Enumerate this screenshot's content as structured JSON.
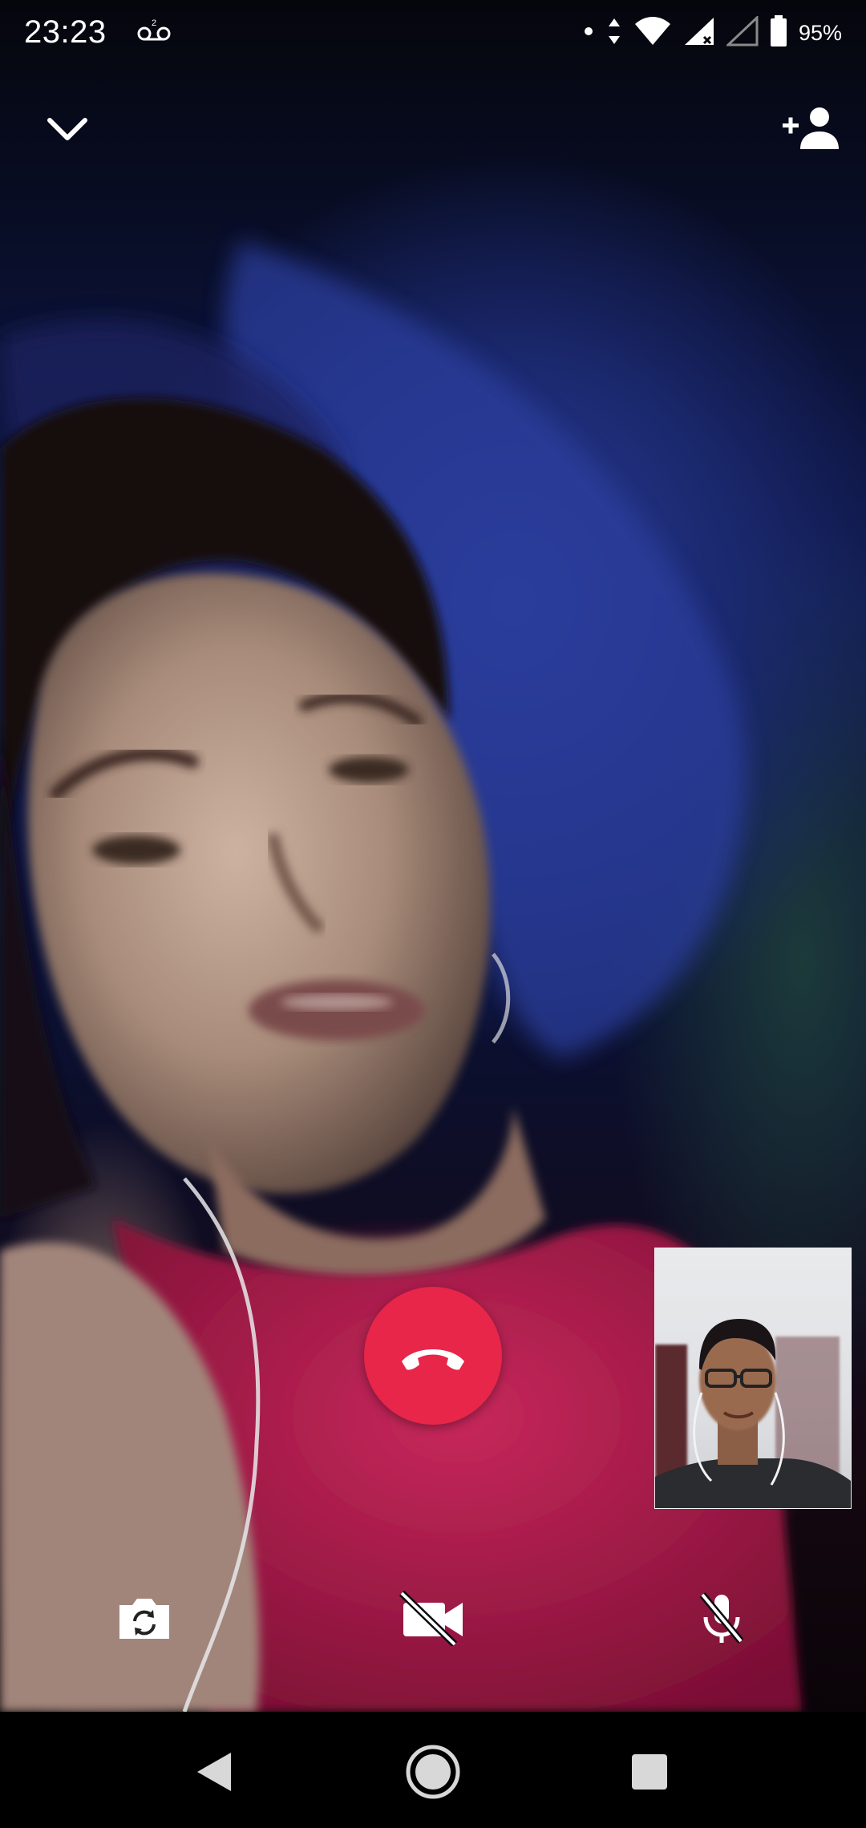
{
  "status_bar": {
    "time": "23:23",
    "battery_percent": "95%",
    "icons": [
      "voicemail-icon",
      "notification-dot-icon",
      "data-arrows-icon",
      "wifi-icon",
      "cell-signal-icon",
      "cell-signal-empty-icon",
      "battery-icon"
    ]
  },
  "call": {
    "top_left_icon": "chevron-down-icon",
    "top_right_icon": "add-person-icon",
    "hangup_icon": "phone-hangup-icon",
    "hangup_color": "#e8264a",
    "controls": [
      {
        "name": "switch-camera",
        "icon": "switch-camera-icon"
      },
      {
        "name": "camera-off",
        "icon": "video-off-icon"
      },
      {
        "name": "mute",
        "icon": "mic-off-icon"
      }
    ]
  },
  "nav_bar": {
    "icons": [
      "back-icon",
      "home-icon",
      "recents-icon"
    ]
  }
}
